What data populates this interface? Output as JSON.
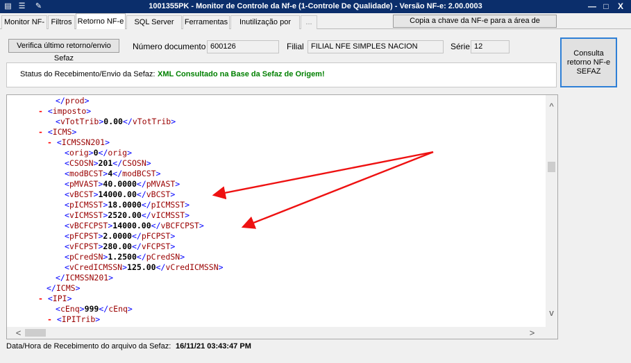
{
  "window": {
    "title": "1001355PK - Monitor de Controle da Nf-e (1-Controle De Qualidade) - Versão NF-e: 2.00.0003",
    "icons": [
      "app-icon",
      "tools-icon",
      "wrench-icon"
    ],
    "controls": {
      "minimize": "—",
      "maximize": "□",
      "close": "X"
    }
  },
  "tabs": [
    {
      "label": "Monitor NF-e",
      "active": false
    },
    {
      "label": "Filtros",
      "active": false
    },
    {
      "label": "Retorno NF-e",
      "active": true
    },
    {
      "label": "SQL Server NF-e",
      "active": false
    },
    {
      "label": "Ferramentas",
      "active": false
    },
    {
      "label": "Inutilização por faixa",
      "active": false
    },
    {
      "label": "...",
      "active": false
    }
  ],
  "copy_button": "Copia a chave da NF-e para a área de transferência",
  "form": {
    "verify_button": "Verifica último retorno/envio Sefaz",
    "numero_label": "Número documento",
    "numero_value": "600126",
    "filial_label": "Filial",
    "filial_value": "FILIAL NFE SIMPLES NACION",
    "serie_label": "Série",
    "serie_value": "12",
    "consulta_button": "Consulta retorno NF-e SEFAZ"
  },
  "status": {
    "label": "Status do Recebimento/Envio da Sefaz:",
    "value": "XML Consultado na Base da Sefaz de Origem!",
    "value_color": "#008000"
  },
  "xml_lines": [
    {
      "marker": "",
      "tag": "prod",
      "close_only": true
    },
    {
      "marker": "-",
      "tag": "imposto",
      "open_only": true
    },
    {
      "marker": "",
      "tag": "vTotTrib",
      "value": "0.00"
    },
    {
      "marker": "-",
      "tag": "ICMS",
      "open_only": true
    },
    {
      "marker": "-",
      "tag": "ICMSSN201",
      "open_only": true
    },
    {
      "marker": "",
      "tag": "orig",
      "value": "0"
    },
    {
      "marker": "",
      "tag": "CSOSN",
      "value": "201"
    },
    {
      "marker": "",
      "tag": "modBCST",
      "value": "4"
    },
    {
      "marker": "",
      "tag": "pMVAST",
      "value": "40.0000"
    },
    {
      "marker": "",
      "tag": "vBCST",
      "value": "14000.00"
    },
    {
      "marker": "",
      "tag": "pICMSST",
      "value": "18.0000"
    },
    {
      "marker": "",
      "tag": "vICMSST",
      "value": "2520.00"
    },
    {
      "marker": "",
      "tag": "vBCFCPST",
      "value": "14000.00"
    },
    {
      "marker": "",
      "tag": "pFCPST",
      "value": "2.0000"
    },
    {
      "marker": "",
      "tag": "vFCPST",
      "value": "280.00"
    },
    {
      "marker": "",
      "tag": "pCredSN",
      "value": "1.2500"
    },
    {
      "marker": "",
      "tag": "vCredICMSSN",
      "value": "125.00"
    },
    {
      "marker": "",
      "tag": "ICMSSN201",
      "close_only": true
    },
    {
      "marker": "",
      "tag": "ICMS",
      "close_only": true
    },
    {
      "marker": "-",
      "tag": "IPI",
      "open_only": true
    },
    {
      "marker": "",
      "tag": "cEnq",
      "value": "999"
    },
    {
      "marker": "-",
      "tag": "IPITrib",
      "open_only": true
    }
  ],
  "scroll": {
    "up": "^",
    "down": "v",
    "left": "<",
    "right": ">"
  },
  "footer": {
    "label": "Data/Hora de Recebimento do arquivo da Sefaz:",
    "value": "16/11/21 03:43:47 PM"
  },
  "annotation_color": "#ee1111"
}
